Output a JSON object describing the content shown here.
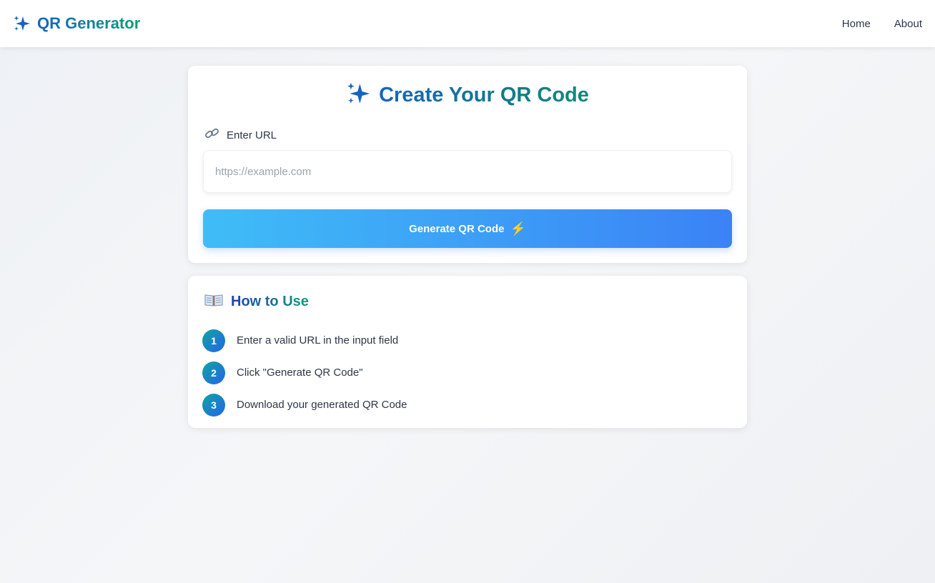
{
  "brand": {
    "icon": "sparkles-icon",
    "title": "QR Generator"
  },
  "nav": {
    "links": [
      "Home",
      "About"
    ]
  },
  "create": {
    "icon": "sparkles-icon",
    "title": "Create Your QR Code",
    "url_label": "Enter URL",
    "url_label_icon": "link-icon",
    "input_value": "",
    "input_placeholder": "https://example.com",
    "button_label": "Generate QR Code",
    "button_icon": "lightning-icon"
  },
  "howto": {
    "icon": "book-icon",
    "title": "How to Use",
    "steps": [
      {
        "num": "1",
        "text": "Enter a valid URL in the input field"
      },
      {
        "num": "2",
        "text": "Click \"Generate QR Code\""
      },
      {
        "num": "3",
        "text": "Download your generated QR Code"
      }
    ]
  },
  "colors": {
    "accent_blue": "#3b82f6",
    "accent_cyan": "#3fbdf7",
    "accent_teal": "#0f9d78",
    "sparkle": "#1565c0",
    "bolt": "#fbbf24"
  }
}
